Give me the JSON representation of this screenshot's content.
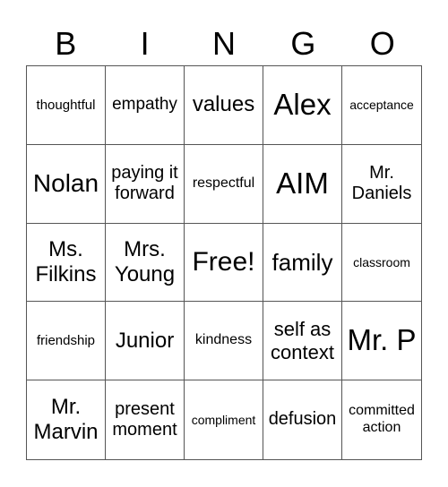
{
  "header": [
    "B",
    "I",
    "N",
    "G",
    "O"
  ],
  "cells": [
    "thoughtful",
    "empathy",
    "values",
    "Alex",
    "acceptance",
    "Nolan",
    "paying it forward",
    "respectful",
    "AIM",
    "Mr. Daniels",
    "Ms. Filkins",
    "Mrs. Young",
    "Free!",
    "family",
    "classroom",
    "friendship",
    "Junior",
    "kindness",
    "self as context",
    "Mr. P",
    "Mr. Marvin",
    "present moment",
    "compliment",
    "defusion",
    "committed action"
  ]
}
